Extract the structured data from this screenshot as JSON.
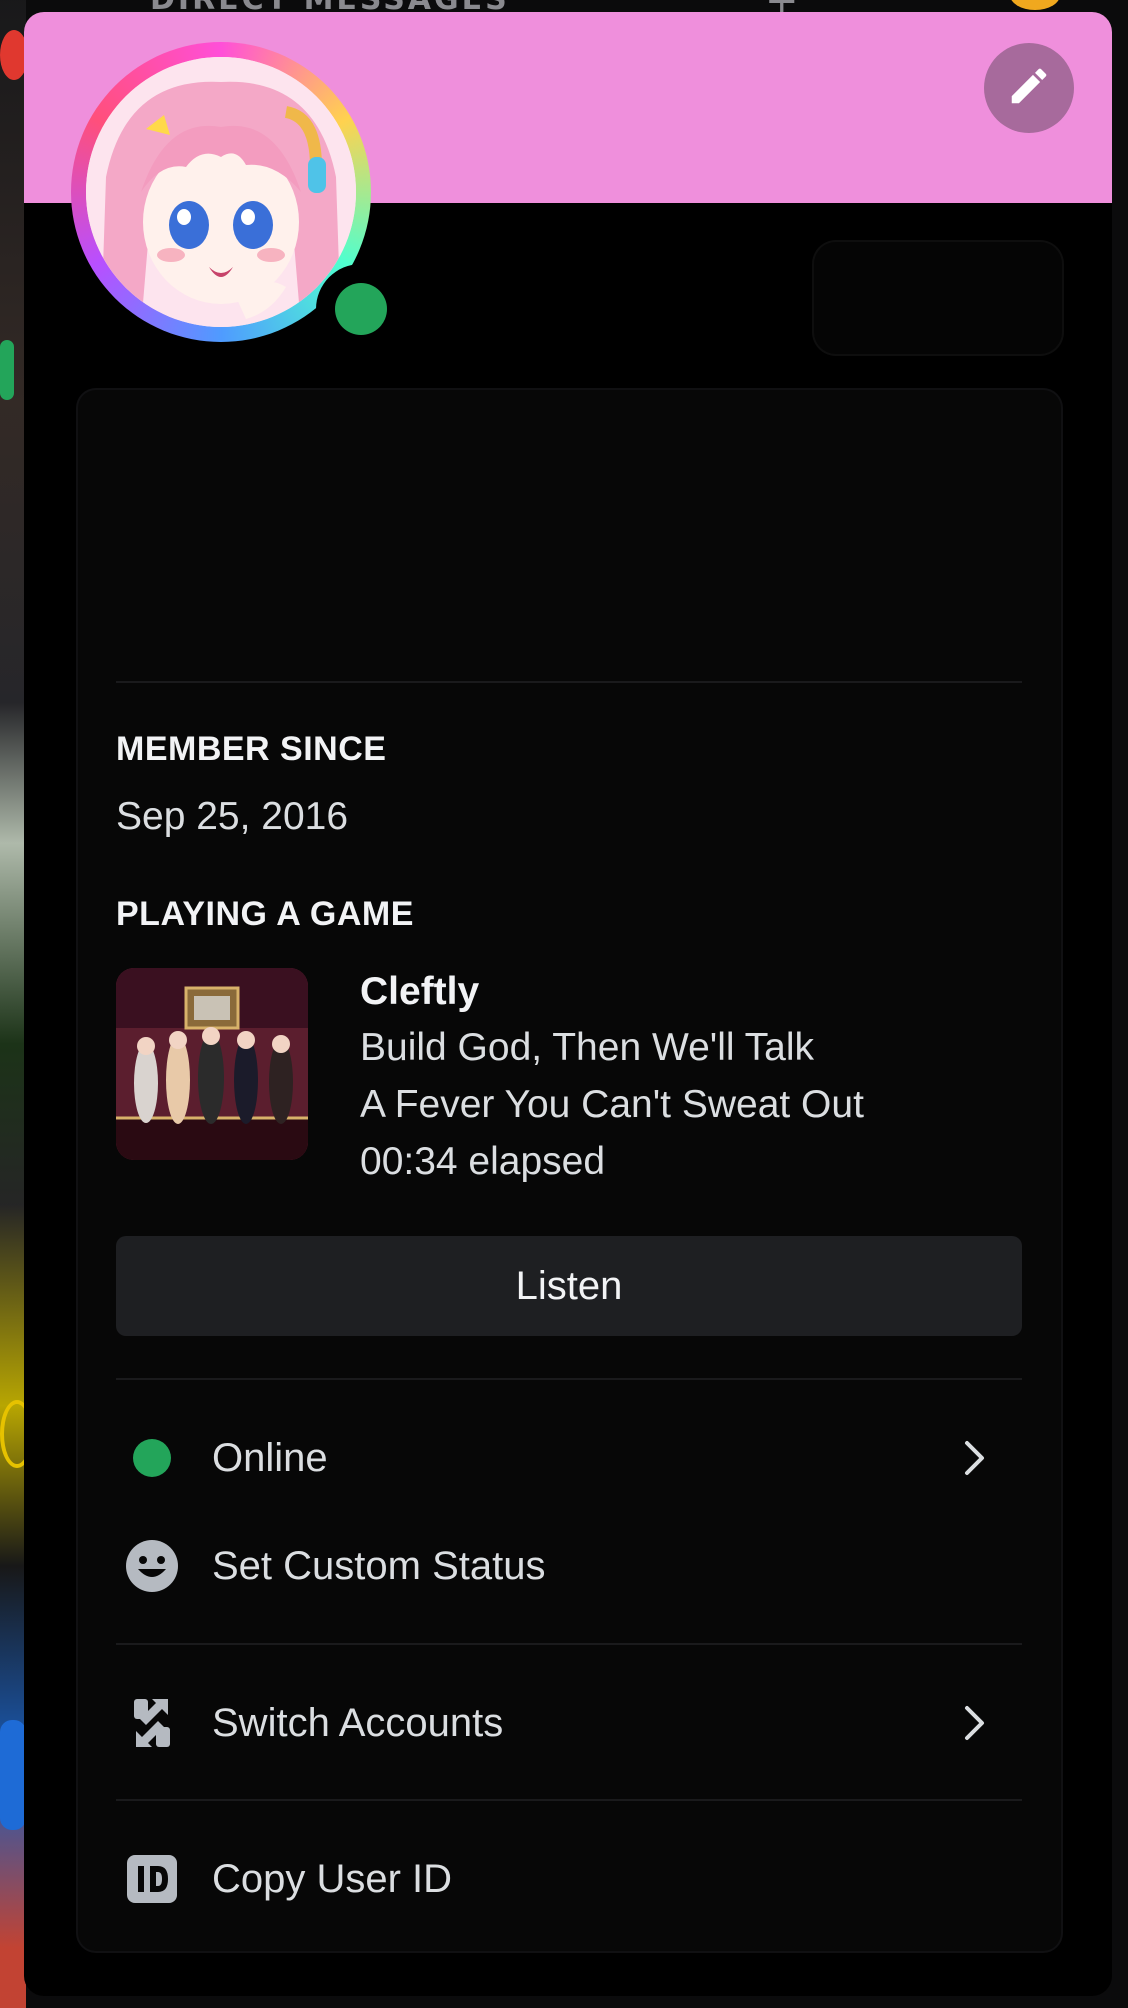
{
  "background": {
    "header_text": "DIRECT MESSAGES",
    "plus_symbol": "+"
  },
  "profile": {
    "status_color": "#23a55a",
    "banner_color": "#ef8fdc"
  },
  "sections": {
    "member_since_label": "MEMBER SINCE",
    "member_since_value": "Sep 25, 2016",
    "activity_label": "PLAYING A GAME"
  },
  "activity": {
    "app_name": "Cleftly",
    "song": "Build God, Then We'll Talk",
    "album": "A Fever You Can't Sweat Out",
    "elapsed": "00:34 elapsed",
    "listen_label": "Listen"
  },
  "menu": {
    "status_label": "Online",
    "custom_status_label": "Set Custom Status",
    "switch_accounts_label": "Switch Accounts",
    "copy_id_label": "Copy User ID"
  }
}
